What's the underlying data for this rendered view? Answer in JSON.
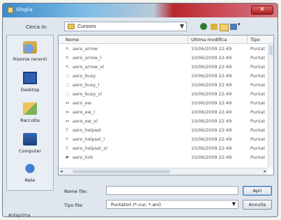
{
  "window": {
    "title": "Sfoglia",
    "close_glyph": "✕"
  },
  "lookin": {
    "label": "Cerca in:",
    "value": "Cursors"
  },
  "places": [
    {
      "label": "Risorse recenti",
      "icon": "recent-places-icon"
    },
    {
      "label": "Desktop",
      "icon": "desktop-icon"
    },
    {
      "label": "Raccolta",
      "icon": "documents-icon"
    },
    {
      "label": "Computer",
      "icon": "computer-icon"
    },
    {
      "label": "Rete",
      "icon": "network-icon"
    }
  ],
  "columns": {
    "name": "Nome",
    "date": "Ultima modifica",
    "type": "Tipo"
  },
  "files": [
    {
      "name": "aero_arrow",
      "date": "10/06/2009 22:49",
      "type": "Puntat"
    },
    {
      "name": "aero_arrow_l",
      "date": "10/06/2009 22:49",
      "type": "Puntat"
    },
    {
      "name": "aero_arrow_xl",
      "date": "10/06/2009 22:49",
      "type": "Puntat"
    },
    {
      "name": "aero_busy",
      "date": "10/06/2009 22:49",
      "type": "Puntat"
    },
    {
      "name": "aero_busy_l",
      "date": "10/06/2009 22:49",
      "type": "Puntat"
    },
    {
      "name": "aero_busy_xl",
      "date": "10/06/2009 22:49",
      "type": "Puntat"
    },
    {
      "name": "aero_ew",
      "date": "10/06/2009 22:49",
      "type": "Puntat"
    },
    {
      "name": "aero_ew_l",
      "date": "10/06/2009 22:49",
      "type": "Puntat"
    },
    {
      "name": "aero_ew_xl",
      "date": "10/06/2009 22:49",
      "type": "Puntat"
    },
    {
      "name": "aero_helpsel",
      "date": "10/06/2009 22:49",
      "type": "Puntat"
    },
    {
      "name": "aero_helpsel_l",
      "date": "10/06/2009 22:49",
      "type": "Puntat"
    },
    {
      "name": "aero_helpsel_xl",
      "date": "10/06/2009 22:49",
      "type": "Puntat"
    },
    {
      "name": "aero_link",
      "date": "10/06/2009 22:49",
      "type": "Puntat"
    }
  ],
  "filename": {
    "label": "Nome file:",
    "value": ""
  },
  "filetype": {
    "label": "Tipo file:",
    "value": "Puntatori (*.cur, *.ani)"
  },
  "buttons": {
    "open": "Apri",
    "cancel": "Annulla"
  },
  "status": "Anteprima"
}
